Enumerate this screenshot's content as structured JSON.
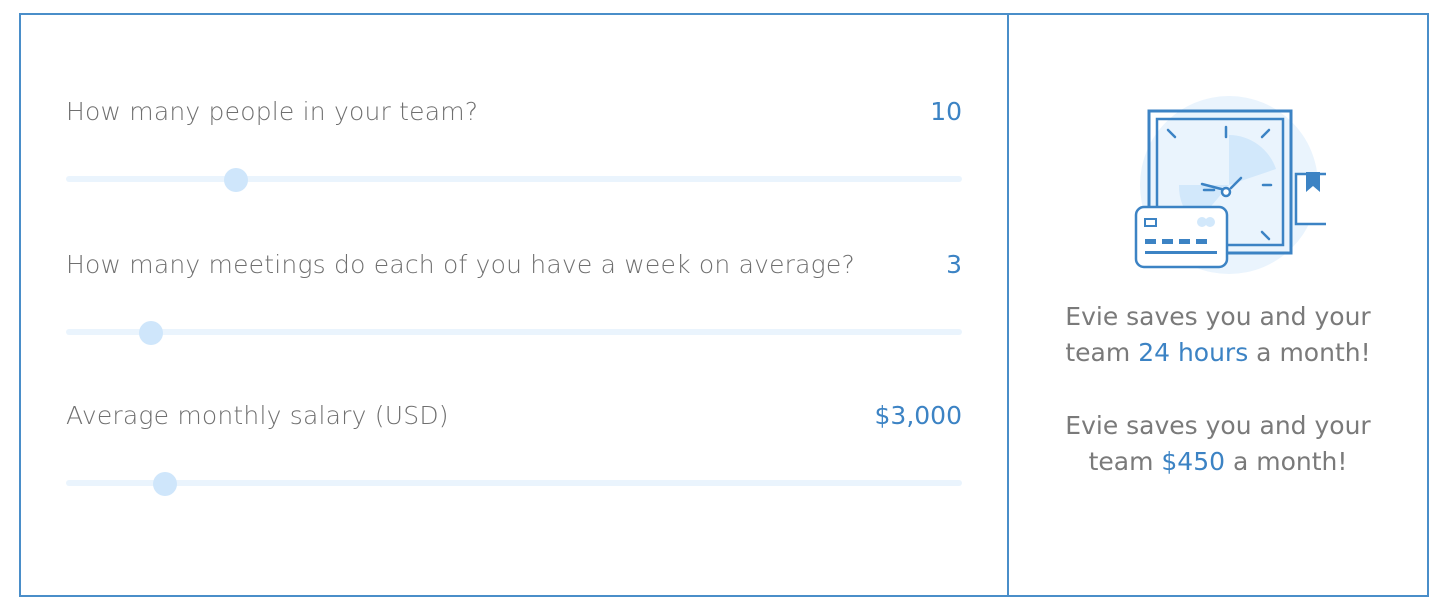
{
  "questions": [
    {
      "label": "How many people in your team?",
      "value": "10",
      "slider_fraction": 0.19
    },
    {
      "label": "How many meetings do each of you have a week on average?",
      "value": "3",
      "slider_fraction": 0.095
    },
    {
      "label": "Average monthly salary (USD)",
      "value": "$3,000",
      "slider_fraction": 0.111
    }
  ],
  "result": {
    "illustration_icon": "clock-card-calendar-icon",
    "hours_line1": "Evie saves you and your",
    "hours_pre": "team ",
    "hours_value": "24 hours",
    "hours_post": " a month!",
    "money_line1": "Evie saves you and your",
    "money_pre": "team ",
    "money_value": "$450",
    "money_post": " a month!"
  },
  "colors": {
    "border": "#4a8ec9",
    "accent": "#3c83c4",
    "label": "#6f6f6f",
    "track": "#eaf4fd",
    "thumb": "#cfe6fb"
  }
}
